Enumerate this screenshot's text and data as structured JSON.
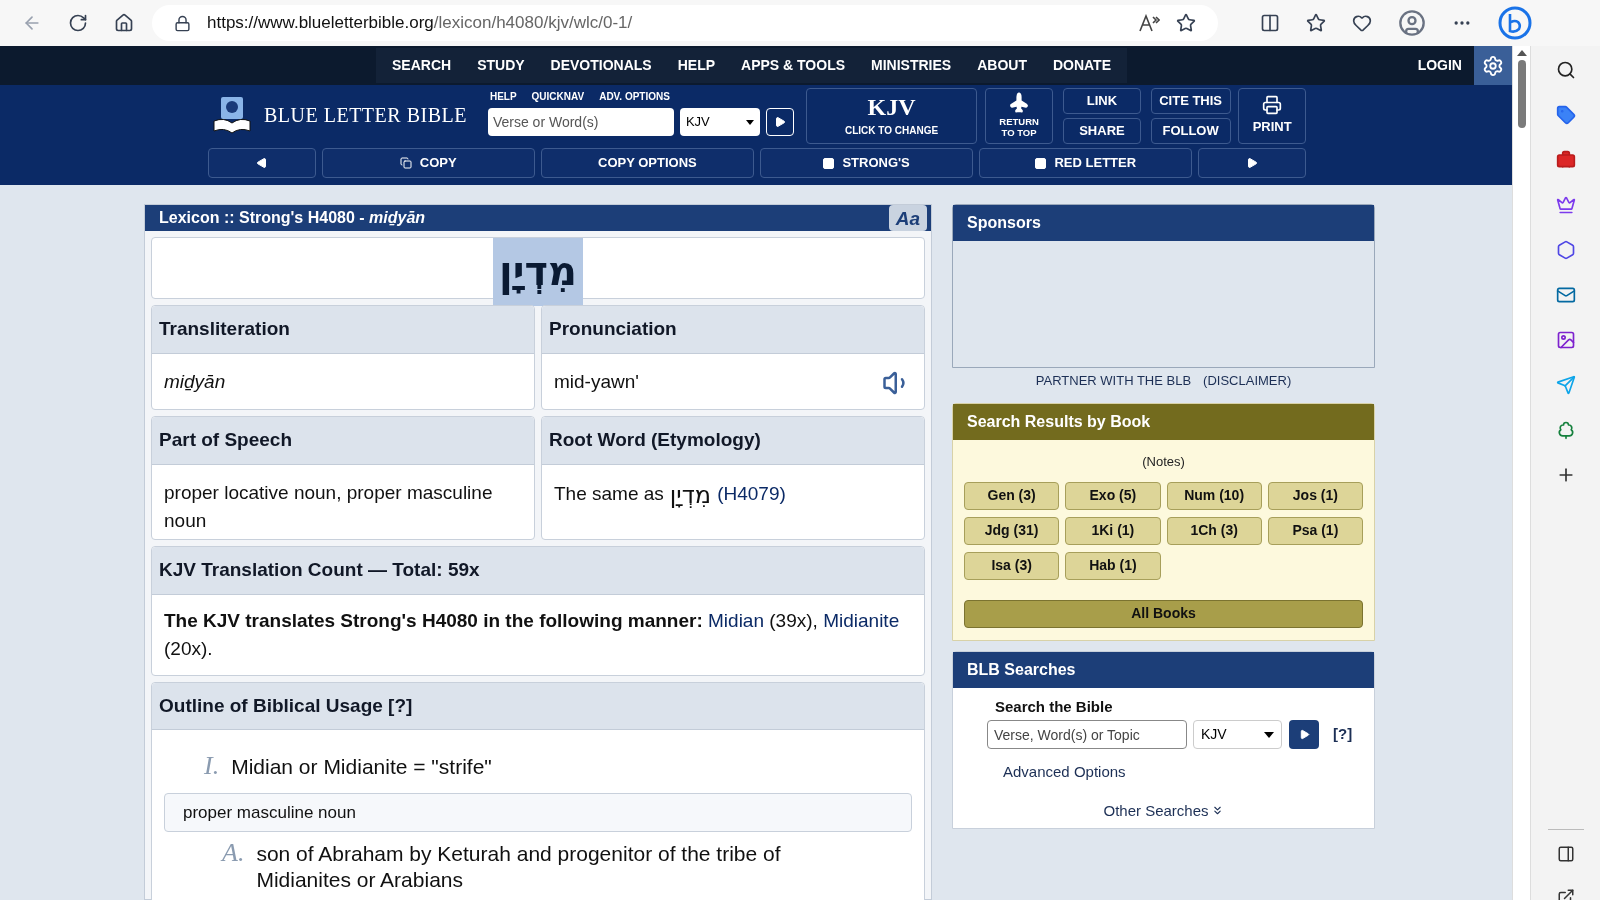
{
  "browser": {
    "url_host": "https://www.blueletterbible.org",
    "url_path": "/lexicon/h4080/kjv/wlc/0-1/"
  },
  "site_nav": {
    "items": [
      "SEARCH",
      "STUDY",
      "DEVOTIONALS",
      "HELP",
      "APPS & TOOLS",
      "MINISTRIES",
      "ABOUT",
      "DONATE"
    ],
    "login": "LOGIN"
  },
  "header": {
    "logo": "BLUE LETTER BIBLE",
    "quick_links": [
      "HELP",
      "QUICKNAV",
      "ADV. OPTIONS"
    ],
    "search": {
      "placeholder": "Verse or Word(s)"
    },
    "version": "KJV",
    "version_button": {
      "label": "KJV",
      "sub": "CLICK TO CHANGE"
    },
    "return_to_top": "RETURN TO TOP",
    "actions": [
      "LINK",
      "CITE THIS",
      "SHARE",
      "FOLLOW"
    ],
    "print": "PRINT"
  },
  "toolbar": [
    {
      "kind": "prev"
    },
    {
      "kind": "copy",
      "label": "COPY"
    },
    {
      "kind": "button",
      "label": "COPY OPTIONS"
    },
    {
      "kind": "checkbox",
      "label": "STRONG'S",
      "checked": false
    },
    {
      "kind": "checkbox",
      "label": "RED LETTER",
      "checked": false
    },
    {
      "kind": "next"
    }
  ],
  "lexicon": {
    "title": "Lexicon :: Strong's H4080 - *miḏyān*",
    "font_button": "Aa",
    "headword": "מִדְיָן",
    "transliteration": {
      "heading": "Transliteration",
      "value": "miḏyān"
    },
    "pronunciation": {
      "heading": "Pronunciation",
      "value": "mid-yawn'"
    },
    "part_of_speech": {
      "heading": "Part of Speech",
      "value": "proper locative noun, proper masculine noun"
    },
    "root_word": {
      "heading": "Root Word (Etymology)",
      "prefix": "The same as",
      "hebrew": "מִדְיָן",
      "link": "(H4079)"
    },
    "translation_count": {
      "heading": "KJV Translation Count — Total: 59x",
      "intro": "The KJV translates Strong's H4080 in the following manner:",
      "items": [
        {
          "word": "Midian",
          "count": "(39x),"
        },
        {
          "word": "Midianite",
          "count": "(20x)."
        }
      ]
    },
    "outline": {
      "heading": "Outline of Biblical Usage [?]",
      "numeral": "I.",
      "text": "Midian or Midianite = \"strife\"",
      "note": "proper masculine noun",
      "sub": [
        {
          "marker": "A.",
          "text": "son of Abraham by Keturah and progenitor of the tribe of Midianites or Arabians"
        }
      ]
    }
  },
  "sponsors": {
    "title": "Sponsors",
    "partner": "PARTNER WITH THE BLB",
    "disclaimer": "(DISCLAIMER)"
  },
  "search_results": {
    "title": "Search Results by Book",
    "notes": "(Notes)",
    "books": [
      "Gen (3)",
      "Exo (5)",
      "Num (10)",
      "Jos (1)",
      "Jdg (31)",
      "1Ki (1)",
      "1Ch (3)",
      "Psa (1)",
      "Isa (3)",
      "Hab (1)"
    ],
    "all": "All Books"
  },
  "blb_searches": {
    "title": "BLB Searches",
    "label": "Search the Bible",
    "placeholder": "Verse, Word(s) or Topic",
    "version": "KJV",
    "help": "[?]",
    "advanced": "Advanced Options",
    "other": "Other Searches"
  }
}
